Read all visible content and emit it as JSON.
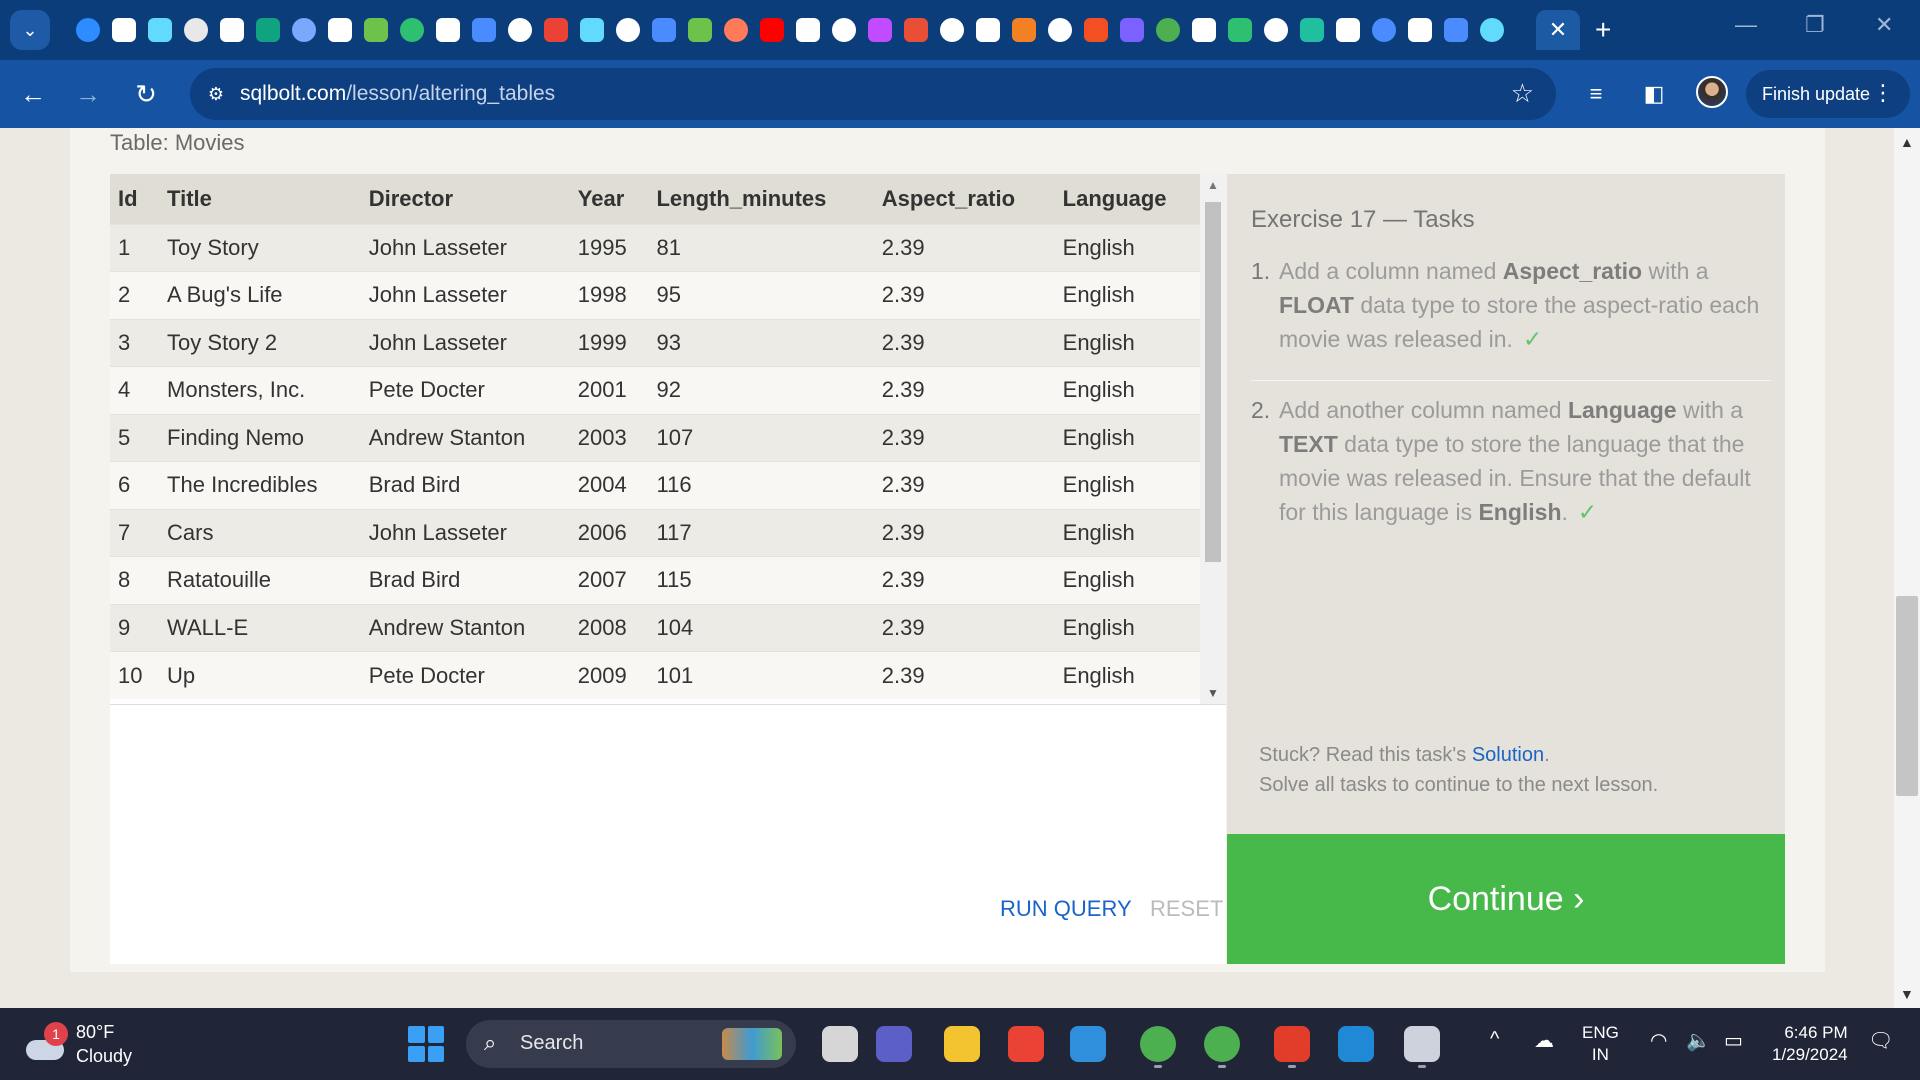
{
  "browser": {
    "favicon_colors": [
      "#2d8cff",
      "#ffffff",
      "#61dafb",
      "#e8e8e8",
      "#ffffff",
      "#10a37f",
      "#7aa8ff",
      "#ffffff",
      "#6cc24a",
      "#2fbf71",
      "#ffffff",
      "#4a8cff",
      "#ffffff",
      "#ea4335",
      "#61dafb",
      "#ffffff",
      "#4a8cff",
      "#6cc24a",
      "#ff7a59",
      "#ff0000",
      "#ffffff",
      "#ffffff",
      "#c04bff",
      "#e94f37",
      "#ffffff",
      "#ffffff",
      "#f48024",
      "#ffffff",
      "#f25022",
      "#7b61ff",
      "#4caf50",
      "#ffffff",
      "#2fbf71",
      "#ffffff",
      "#1fbf9f",
      "#ffffff",
      "#4a8cff",
      "#ffffff",
      "#4a8cff",
      "#61dafb"
    ],
    "active_tab_close": "✕",
    "new_tab": "+",
    "url_host": "sqlbolt.com",
    "url_path": "/lesson/altering_tables",
    "finish_update": "Finish update"
  },
  "page": {
    "table_caption": "Table: Movies",
    "columns": [
      "Id",
      "Title",
      "Director",
      "Year",
      "Length_minutes",
      "Aspect_ratio",
      "Language"
    ],
    "rows": [
      [
        "1",
        "Toy Story",
        "John Lasseter",
        "1995",
        "81",
        "2.39",
        "English"
      ],
      [
        "2",
        "A Bug's Life",
        "John Lasseter",
        "1998",
        "95",
        "2.39",
        "English"
      ],
      [
        "3",
        "Toy Story 2",
        "John Lasseter",
        "1999",
        "93",
        "2.39",
        "English"
      ],
      [
        "4",
        "Monsters, Inc.",
        "Pete Docter",
        "2001",
        "92",
        "2.39",
        "English"
      ],
      [
        "5",
        "Finding Nemo",
        "Andrew Stanton",
        "2003",
        "107",
        "2.39",
        "English"
      ],
      [
        "6",
        "The Incredibles",
        "Brad Bird",
        "2004",
        "116",
        "2.39",
        "English"
      ],
      [
        "7",
        "Cars",
        "John Lasseter",
        "2006",
        "117",
        "2.39",
        "English"
      ],
      [
        "8",
        "Ratatouille",
        "Brad Bird",
        "2007",
        "115",
        "2.39",
        "English"
      ],
      [
        "9",
        "WALL-E",
        "Andrew Stanton",
        "2008",
        "104",
        "2.39",
        "English"
      ],
      [
        "10",
        "Up",
        "Pete Docter",
        "2009",
        "101",
        "2.39",
        "English"
      ]
    ],
    "run_query": "RUN QUERY",
    "reset": "RESET",
    "tasks_title": "Exercise 17 — Tasks",
    "tasks": [
      {
        "num": "1.",
        "parts": [
          {
            "t": "Add a column named ",
            "b": false
          },
          {
            "t": "Aspect_ratio",
            "b": true
          },
          {
            "t": " with a ",
            "b": false
          },
          {
            "t": "FLOAT",
            "b": true
          },
          {
            "t": " data type to store the aspect-ratio each movie was released in.",
            "b": false
          }
        ],
        "done": "✓"
      },
      {
        "num": "2.",
        "parts": [
          {
            "t": "Add another column named ",
            "b": false
          },
          {
            "t": "Language",
            "b": true
          },
          {
            "t": " with a ",
            "b": false
          },
          {
            "t": "TEXT",
            "b": true
          },
          {
            "t": " data type to store the language that the movie was released in. Ensure that the default for this language is ",
            "b": false
          },
          {
            "t": "English",
            "b": true
          },
          {
            "t": ".",
            "b": false
          }
        ],
        "done": "✓"
      }
    ],
    "stuck_prefix": "Stuck? Read this task's ",
    "stuck_link": "Solution",
    "stuck_suffix": ".",
    "solve_all": "Solve all tasks to continue to the next lesson.",
    "continue": "Continue ›"
  },
  "taskbar": {
    "weather_badge": "1",
    "weather_temp": "80°F",
    "weather_desc": "Cloudy",
    "search_placeholder": "Search",
    "lang_1": "ENG",
    "lang_2": "IN",
    "time": "6:46 PM",
    "date": "1/29/2024",
    "app_colors": [
      "#d6d6d6",
      "#5b5fc7",
      "#f4c430",
      "#ea4335",
      "#2f8fdc",
      "#4caf50",
      "#4caf50",
      "#e23d2a",
      "#1f89d6",
      "#cdd2dc"
    ]
  }
}
